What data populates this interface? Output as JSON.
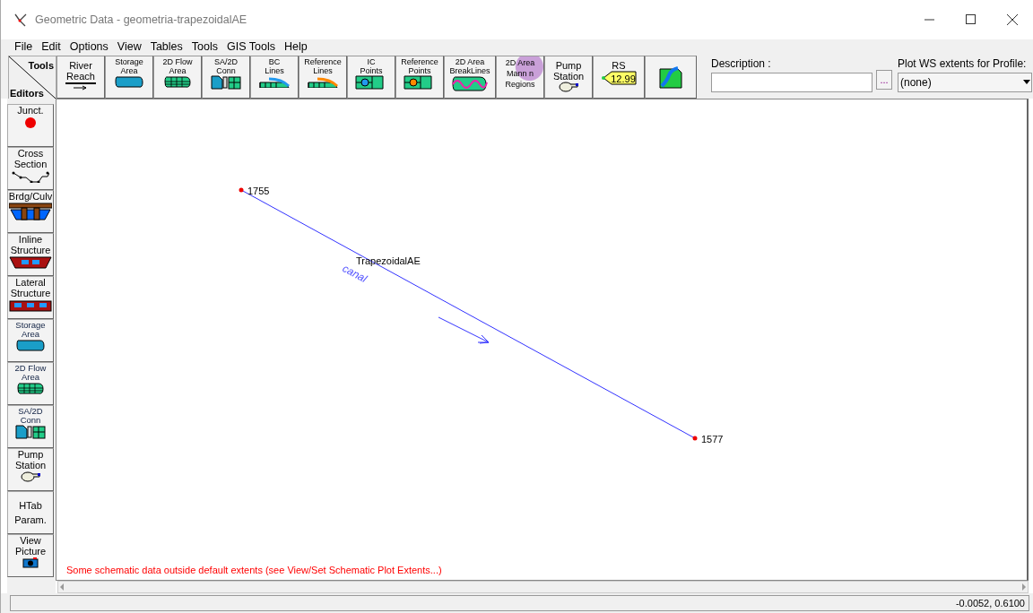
{
  "window": {
    "title": "Geometric Data - geometria-trapezoidalAE"
  },
  "menu": [
    "File",
    "Edit",
    "Options",
    "View",
    "Tables",
    "Tools",
    "GIS Tools",
    "Help"
  ],
  "toolbar": {
    "corner_top": "Tools",
    "corner_bottom": "Editors",
    "tools": [
      {
        "kind": "reach",
        "lines": [
          "River",
          "Reach"
        ]
      },
      {
        "kind": "storage",
        "lines": [
          "Storage",
          "Area"
        ]
      },
      {
        "kind": "flow2d",
        "lines": [
          "2D Flow",
          "Area"
        ]
      },
      {
        "kind": "conn",
        "lines": [
          "SA/2D",
          "Conn"
        ]
      },
      {
        "kind": "bc",
        "lines": [
          "BC",
          "Lines"
        ]
      },
      {
        "kind": "reflines",
        "lines": [
          "Reference",
          "Lines"
        ]
      },
      {
        "kind": "icpoints",
        "lines": [
          "IC",
          "Points"
        ]
      },
      {
        "kind": "refpoints",
        "lines": [
          "Reference",
          "Points"
        ]
      },
      {
        "kind": "breaklines",
        "lines": [
          "2D Area",
          "BreakLines"
        ]
      },
      {
        "kind": "mann",
        "lines": [
          "2D Area",
          "Mann n",
          "Regions"
        ]
      },
      {
        "kind": "pump",
        "lines": [
          "Pump",
          "Station"
        ]
      },
      {
        "kind": "rs",
        "lines": [
          "RS"
        ],
        "tag": "12.99"
      },
      {
        "kind": "map"
      }
    ]
  },
  "description": {
    "label": "Description :",
    "browse": "..."
  },
  "profile": {
    "label": "Plot WS extents for Profile:",
    "value": "(none)"
  },
  "sidebar": [
    {
      "kind": "junction",
      "lines": [
        "Junct."
      ]
    },
    {
      "kind": "xs",
      "lines": [
        "Cross",
        "Section"
      ]
    },
    {
      "kind": "bridge",
      "lines": [
        "Brdg/Culv"
      ]
    },
    {
      "kind": "inline",
      "lines": [
        "Inline",
        "Structure"
      ]
    },
    {
      "kind": "lateral",
      "lines": [
        "Lateral",
        "Structure"
      ]
    },
    {
      "kind": "storage",
      "lines": [
        "Storage",
        "Area"
      ]
    },
    {
      "kind": "flow2d",
      "lines": [
        "2D Flow",
        "Area"
      ]
    },
    {
      "kind": "conn",
      "lines": [
        "SA/2D",
        "Conn"
      ]
    },
    {
      "kind": "pump",
      "lines": [
        "Pump",
        "Station"
      ]
    },
    {
      "kind": "none",
      "lines": [
        "HTab",
        "Param."
      ]
    },
    {
      "kind": "camera",
      "lines": [
        "View",
        "Picture"
      ]
    }
  ],
  "schematic": {
    "nodes": [
      {
        "label": "1755"
      },
      {
        "label": "1577"
      }
    ],
    "reach": "TrapezoidalAE",
    "river": "canal",
    "message": "Some schematic data outside default extents (see View/Set Schematic Plot Extents...)"
  },
  "status": {
    "coordinates": "-0.0052, 0.6100"
  }
}
